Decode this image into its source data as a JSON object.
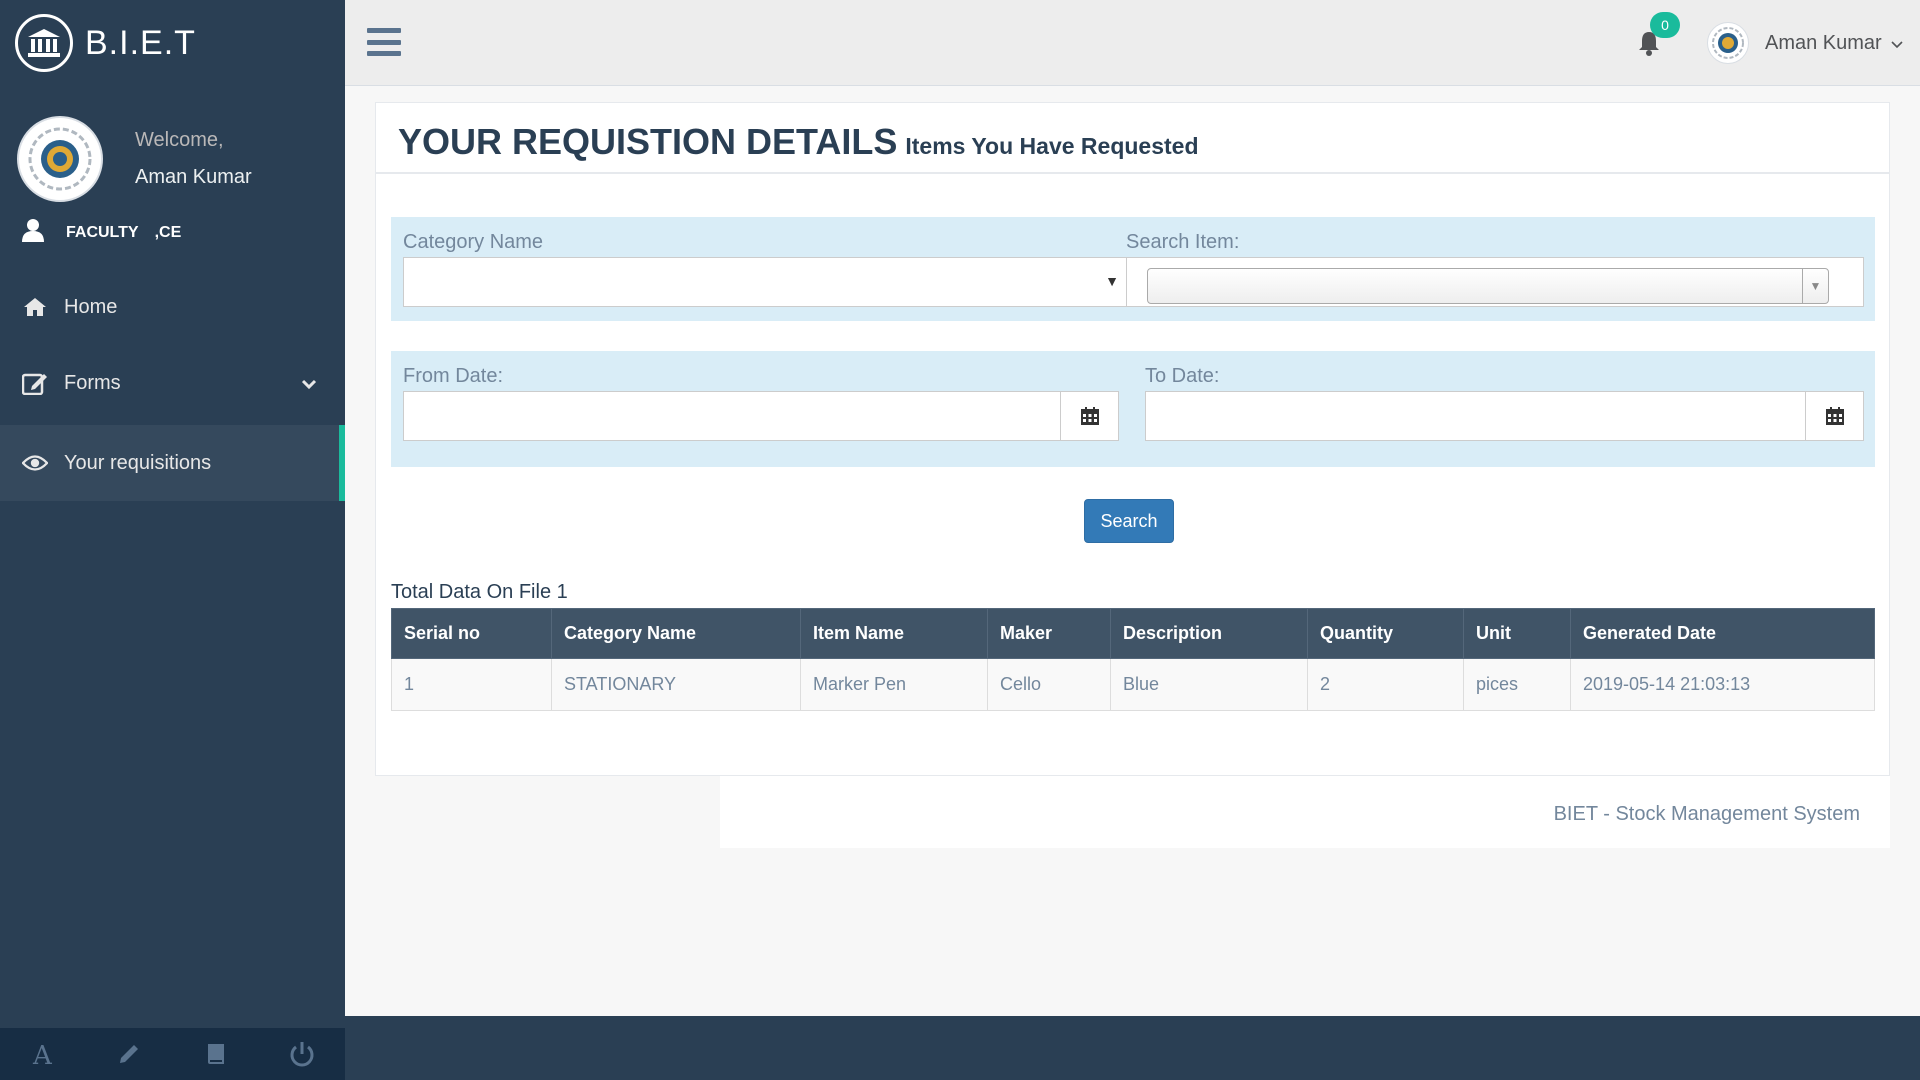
{
  "brand": {
    "title": "B.I.E.T"
  },
  "profile": {
    "welcome": "Welcome,",
    "name": "Aman Kumar",
    "role": "FACULTY",
    "dept": ",CE"
  },
  "menu": {
    "home": "Home",
    "forms": "Forms",
    "requisitions": "Your requisitions"
  },
  "topnav": {
    "notification_count": "0",
    "user_name": "Aman Kumar"
  },
  "panel": {
    "title": "YOUR REQUISTION DETAILS",
    "subtitle": "Items You Have Requested"
  },
  "filters": {
    "category_label": "Category Name",
    "search_item_label": "Search Item:",
    "from_date_label": "From Date:",
    "to_date_label": "To Date:",
    "category_value": "",
    "search_item_value": "",
    "from_date_value": "",
    "to_date_value": ""
  },
  "search_button": "Search",
  "total_label": "Total Data On File 1",
  "table": {
    "headers": [
      "Serial no",
      "Category Name",
      "Item Name",
      "Maker",
      "Description",
      "Quantity",
      "Unit",
      "Generated Date"
    ],
    "rows": [
      [
        "1",
        "STATIONARY",
        "Marker Pen",
        "Cello",
        "Blue",
        "2",
        "pices",
        "2019-05-14 21:03:13"
      ]
    ]
  },
  "footer": {
    "text": "BIET - Stock Management System"
  },
  "colors": {
    "sidebar": "#2a3f54",
    "accent": "#1abb9c",
    "primary_button": "#337ab7",
    "filter_bg": "#d9edf7",
    "table_header": "#405467"
  }
}
